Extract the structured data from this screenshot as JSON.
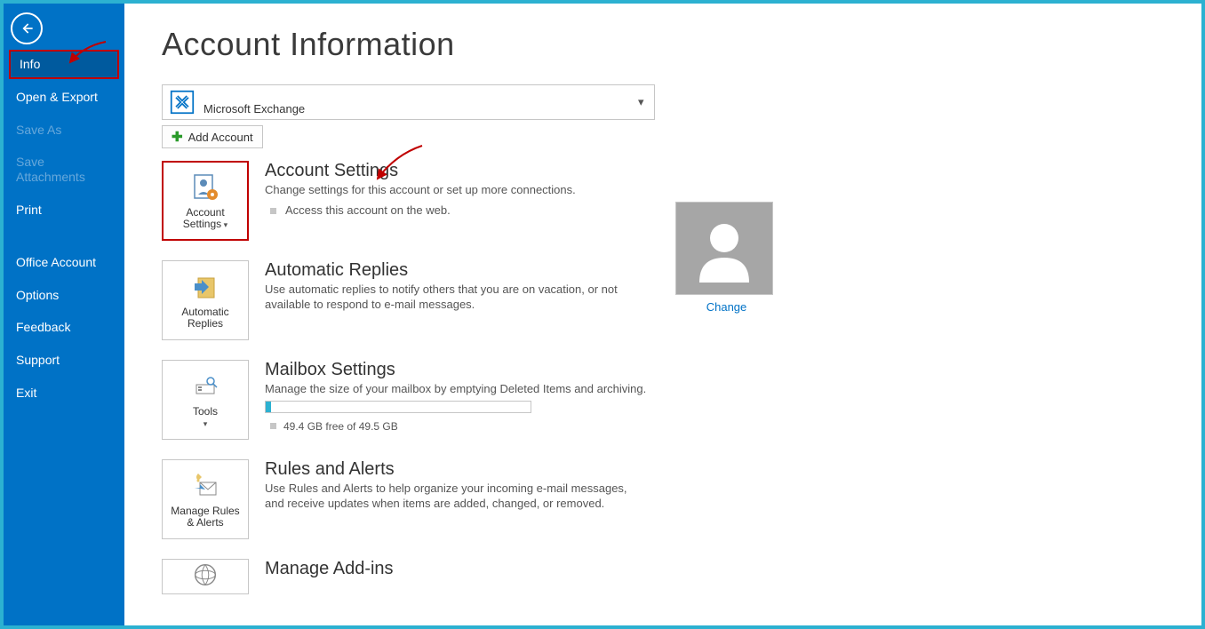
{
  "sidebar": {
    "items": [
      {
        "label": "Info",
        "selected": true
      },
      {
        "label": "Open & Export"
      },
      {
        "label": "Save As",
        "disabled": true
      },
      {
        "label": "Save Attachments",
        "disabled": true
      },
      {
        "label": "Print"
      },
      {
        "label": "Office Account",
        "sep_before": true
      },
      {
        "label": "Options"
      },
      {
        "label": "Feedback"
      },
      {
        "label": "Support"
      },
      {
        "label": "Exit"
      }
    ]
  },
  "page": {
    "title": "Account Information"
  },
  "account_selector": {
    "type": "Microsoft Exchange"
  },
  "add_account_label": "Add Account",
  "sections": {
    "account_settings": {
      "tile_label": "Account Settings",
      "heading": "Account Settings",
      "desc": "Change settings for this account or set up more connections.",
      "bullet": "Access this account on the web."
    },
    "profile": {
      "change_label": "Change"
    },
    "auto_replies": {
      "tile_label": "Automatic Replies",
      "heading": "Automatic Replies",
      "desc": "Use automatic replies to notify others that you are on vacation, or not available to respond to e-mail messages."
    },
    "mailbox": {
      "tile_label": "Tools",
      "heading": "Mailbox Settings",
      "desc": "Manage the size of your mailbox by emptying Deleted Items and archiving.",
      "storage": "49.4 GB free of 49.5 GB"
    },
    "rules": {
      "tile_label": "Manage Rules & Alerts",
      "heading": "Rules and Alerts",
      "desc": "Use Rules and Alerts to help organize your incoming e-mail messages, and receive updates when items are added, changed, or removed."
    },
    "addins": {
      "heading": "Manage Add-ins"
    }
  }
}
